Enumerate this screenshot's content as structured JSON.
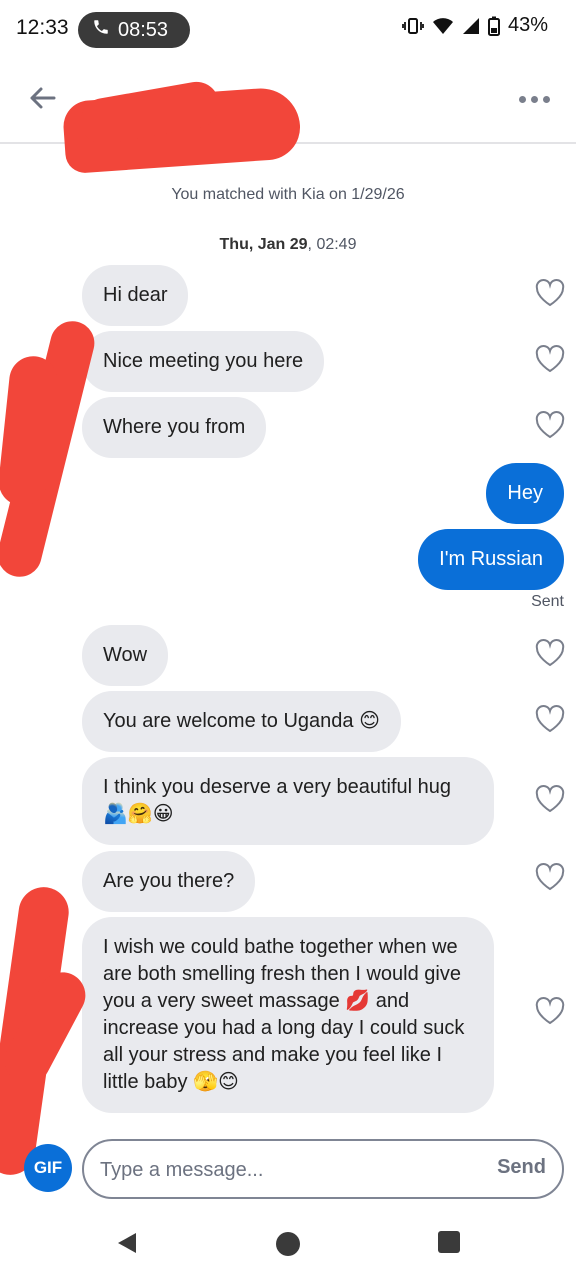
{
  "status_bar": {
    "time": "12:33",
    "call_duration": "08:53",
    "battery": "43%"
  },
  "header": {
    "back_icon": "arrow-left-icon",
    "more_icon": "more-horizontal-icon"
  },
  "conversation": {
    "match_note": "You matched with Kia on 1/29/26",
    "date_day": "Thu, Jan 29",
    "date_time": ", 02:49",
    "messages_in_1": [
      "Hi dear",
      "Nice meeting you here",
      "Where you from"
    ],
    "messages_out": [
      "Hey",
      "I'm Russian"
    ],
    "sent_status": "Sent",
    "messages_in_2": [
      "Wow",
      "You are welcome to Uganda 😊",
      "I think you deserve a very beautiful hug 🫂🤗😀",
      "Are you there?",
      "I wish we could bathe together when we are both smelling fresh then I would give you a very sweet massage 💋 and increase you had a long day I could suck all your stress and make you feel like I little baby 🫣😊"
    ]
  },
  "composer": {
    "gif_label": "GIF",
    "placeholder": "Type a message...",
    "send_label": "Send"
  },
  "colors": {
    "accent": "#0a6fd8",
    "incoming_bubble": "#e9eaee",
    "redaction": "#f2463a"
  }
}
